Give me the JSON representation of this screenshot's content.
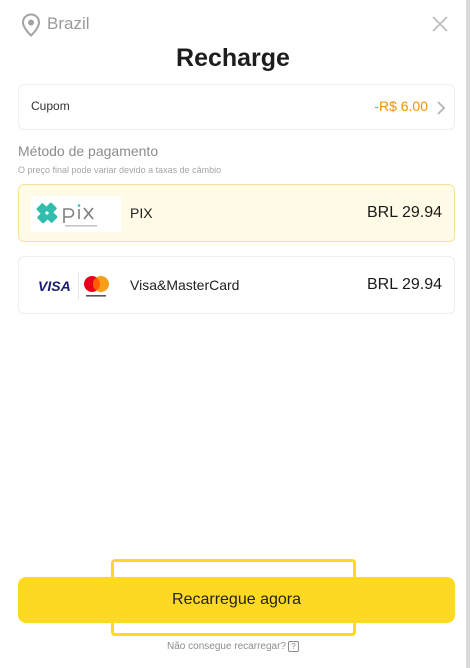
{
  "header": {
    "location": "Brazil",
    "location_icon": "location-pin-icon",
    "close_icon": "close-icon",
    "title": "Recharge"
  },
  "coupon": {
    "label": "Cupom",
    "value": "-R$ 6.00",
    "chevron_icon": "chevron-right-icon"
  },
  "payment": {
    "section_title": "Método de pagamento",
    "notice": "O preço final pode variar devido a taxas de câmbio",
    "methods": [
      {
        "name": "PIX",
        "price": "BRL 29.94",
        "logo": "pix-logo",
        "selected": true
      },
      {
        "name": "Visa&MasterCard",
        "price": "BRL 29.94",
        "logo": "visa-mastercard-logo",
        "selected": false
      }
    ]
  },
  "actions": {
    "recharge_label": "Recarregue agora",
    "help_label": "Não consegue recarregar?",
    "help_icon": "question-icon"
  },
  "colors": {
    "accent": "#fed922",
    "coupon_value": "#f0900a",
    "selected_bg": "#fffbe6"
  }
}
